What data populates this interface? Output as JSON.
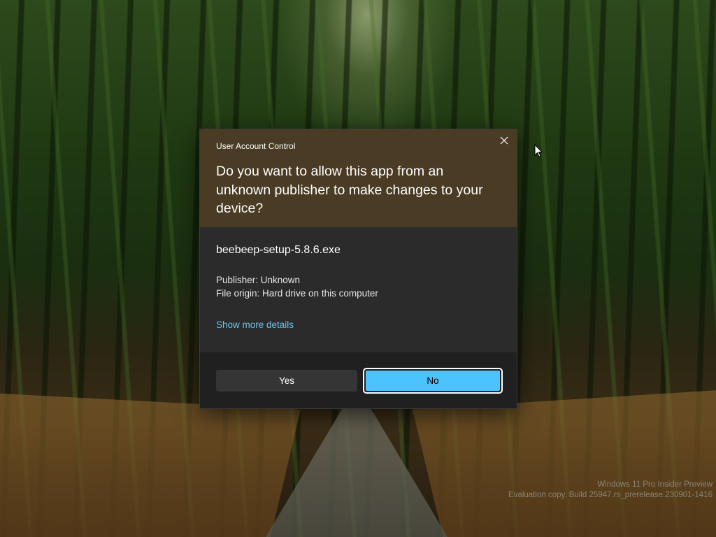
{
  "dialog": {
    "title": "User Account Control",
    "question": "Do you want to allow this app from an unknown publisher to make changes to your device?",
    "app_name": "beebeep-setup-5.8.6.exe",
    "publisher": "Publisher: Unknown",
    "file_origin": "File origin: Hard drive on this computer",
    "more_details": "Show more details",
    "yes_label": "Yes",
    "no_label": "No",
    "close_icon": "close-icon"
  },
  "watermark": {
    "line1": "Windows 11 Pro Insider Preview",
    "line2": "Evaluation copy. Build 25947.rs_prerelease.230901-1416"
  },
  "colors": {
    "header_bg": "#4a3c24",
    "body_bg": "#2b2b2b",
    "footer_bg": "#202020",
    "accent": "#4cc2ff",
    "link": "#69c3e8"
  }
}
